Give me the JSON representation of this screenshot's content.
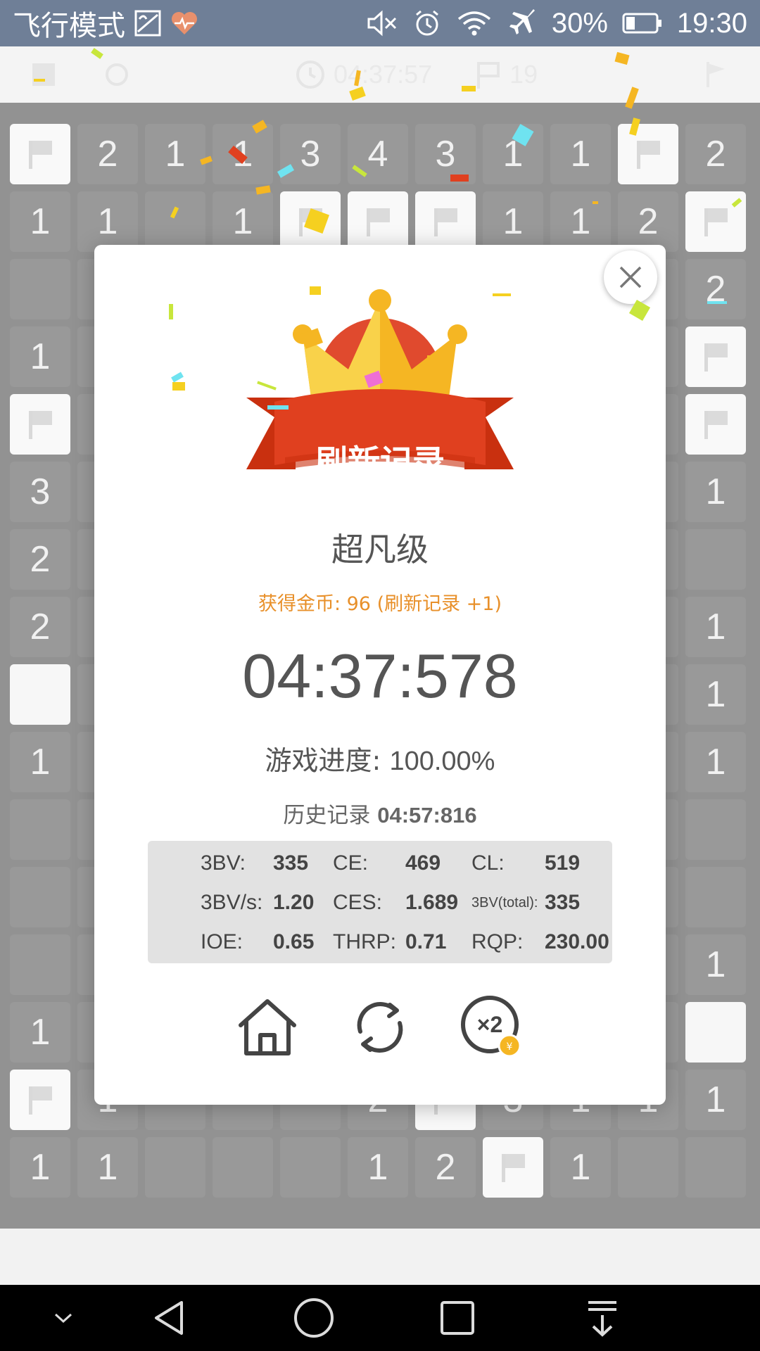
{
  "status_bar": {
    "mode_text": "飞行模式",
    "battery_text": "30%",
    "time": "19:30"
  },
  "game_toolbar": {
    "timer": "04:37:57",
    "flags": "19"
  },
  "board": {
    "cells": [
      [
        "flag",
        "2",
        "1",
        "1",
        "3",
        "4",
        "3",
        "1",
        "1",
        "flag",
        "2"
      ],
      [
        "1",
        "1",
        "",
        "1",
        "flag",
        "flag",
        "flag",
        "1",
        "1",
        "2",
        "flag"
      ],
      [
        "",
        "",
        "",
        "",
        "",
        "",
        "",
        "",
        "",
        "",
        "2"
      ],
      [
        "1",
        "",
        "",
        "",
        "",
        "",
        "",
        "",
        "",
        "",
        "flag"
      ],
      [
        "flag",
        "",
        "",
        "",
        "",
        "",
        "",
        "",
        "",
        "",
        "flag"
      ],
      [
        "3",
        "",
        "",
        "",
        "",
        "",
        "",
        "",
        "",
        "",
        "1"
      ],
      [
        "2",
        "",
        "",
        "",
        "",
        "",
        "",
        "",
        "",
        "",
        ""
      ],
      [
        "2",
        "",
        "",
        "",
        "",
        "",
        "",
        "",
        "",
        "",
        "1"
      ],
      [
        "open",
        "",
        "",
        "",
        "",
        "",
        "",
        "",
        "",
        "",
        "1"
      ],
      [
        "1",
        "",
        "",
        "",
        "",
        "",
        "",
        "",
        "",
        "",
        "1"
      ],
      [
        "",
        "",
        "",
        "",
        "",
        "",
        "",
        "",
        "",
        "",
        ""
      ],
      [
        "",
        "",
        "",
        "",
        "",
        "",
        "",
        "",
        "",
        "",
        ""
      ],
      [
        "",
        "",
        "",
        "",
        "",
        "",
        "",
        "",
        "",
        "",
        "1"
      ],
      [
        "1",
        "",
        "",
        "",
        "",
        "",
        "",
        "",
        "",
        "",
        "open"
      ],
      [
        "flag",
        "1",
        "",
        "",
        "",
        "2",
        "flag",
        "3",
        "1",
        "1",
        "1"
      ],
      [
        "1",
        "1",
        "",
        "",
        "",
        "1",
        "2",
        "flag",
        "1",
        "",
        ""
      ]
    ]
  },
  "modal": {
    "banner_text": "刷新记录",
    "level": "超凡级",
    "coins_text": "获得金币: 96 (刷新记录 +1)",
    "time": "04:37:578",
    "progress_label": "游戏进度:",
    "progress_value": "100.00%",
    "history_label": "历史记录",
    "history_value": "04:57:816",
    "stats": {
      "row1": {
        "l1": "3BV:",
        "v1": "335",
        "l2": "CE:",
        "v2": "469",
        "l3": "CL:",
        "v3": "519"
      },
      "row2": {
        "l1": "3BV/s:",
        "v1": "1.20",
        "l2": "CES:",
        "v2": "1.689",
        "l3": "3BV(total):",
        "v3": "335"
      },
      "row3": {
        "l1": "IOE:",
        "v1": "0.65",
        "l2": "THRP:",
        "v2": "0.71",
        "l3": "RQP:",
        "v3": "230.00"
      }
    },
    "actions": {
      "home": "home-icon",
      "restart": "restart-icon",
      "double": "×2",
      "coin_symbol": "¥"
    }
  },
  "colors": {
    "status_bar": "#6f7f97",
    "accent_orange": "#e8902a",
    "banner_red": "#e0401f",
    "crown_gold": "#f5b623"
  }
}
